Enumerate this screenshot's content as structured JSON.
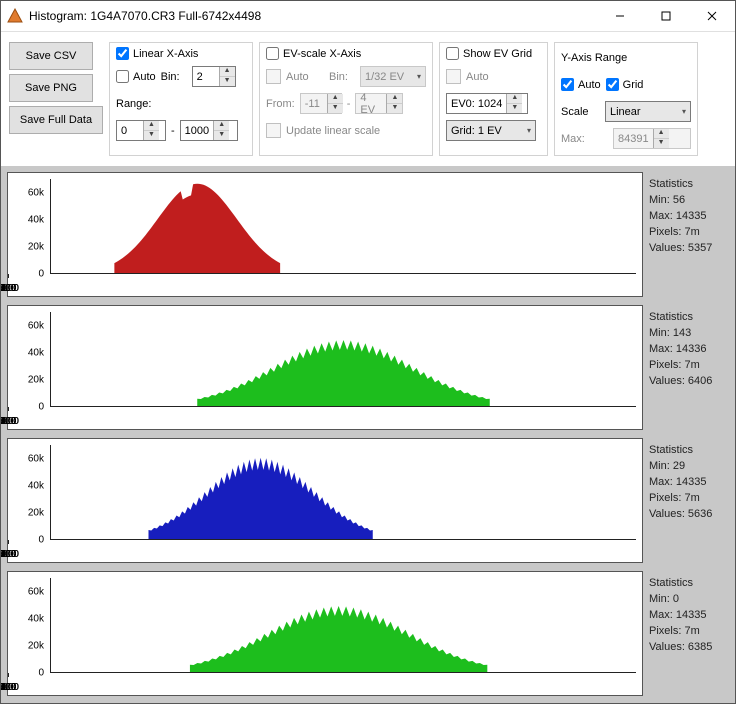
{
  "window": {
    "title": "Histogram: 1G4A7070.CR3 Full-6742x4498"
  },
  "buttons": {
    "saveCsv": "Save CSV",
    "savePng": "Save PNG",
    "saveFull": "Save Full Data"
  },
  "linearGroup": {
    "title": "Linear X-Axis",
    "auto": "Auto",
    "binLabel": "Bin:",
    "bin": "2",
    "rangeLabel": "Range:",
    "from": "0",
    "to": "1000"
  },
  "evGroup": {
    "title": "EV-scale X-Axis",
    "auto": "Auto",
    "binLabel": "Bin:",
    "binSel": "1/32 EV",
    "fromLabel": "From:",
    "from": "-11",
    "dash": "-",
    "to": "4 EV",
    "update": "Update linear scale"
  },
  "gridGroup": {
    "title": "Show EV Grid",
    "auto": "Auto",
    "ev0": "EV0: 1024",
    "gridSel": "Grid: 1 EV"
  },
  "yGroup": {
    "title": "Y-Axis Range",
    "auto": "Auto",
    "grid": "Grid",
    "scale": "Scale",
    "scaleSel": "Linear",
    "maxLabel": "Max:",
    "maxVal": "84391"
  },
  "axes": {
    "y": [
      "60k",
      "40k",
      "20k",
      "0"
    ],
    "x": [
      "0",
      "100",
      "200",
      "300",
      "400",
      "500",
      "600",
      "700",
      "800",
      "900",
      "1000",
      "1100"
    ]
  },
  "chart_data": [
    {
      "type": "area",
      "color": "#C01E1E",
      "center": 300,
      "halfwidth": 170,
      "height": 0.95,
      "notch": true,
      "xrange": [
        0,
        1200
      ],
      "ymax": 70000,
      "jagged": false
    },
    {
      "type": "area",
      "color": "#1DBE1D",
      "center": 600,
      "halfwidth": 300,
      "height": 0.65,
      "notch": false,
      "xrange": [
        0,
        1200
      ],
      "ymax": 70000,
      "jagged": true
    },
    {
      "type": "area",
      "color": "#171EBE",
      "center": 430,
      "halfwidth": 230,
      "height": 0.8,
      "notch": false,
      "xrange": [
        0,
        1200
      ],
      "ymax": 70000,
      "jagged": true
    },
    {
      "type": "area",
      "color": "#1DBE1D",
      "center": 590,
      "halfwidth": 305,
      "height": 0.65,
      "notch": false,
      "xrange": [
        0,
        1200
      ],
      "ymax": 70000,
      "jagged": true
    }
  ],
  "stats": [
    {
      "title": "Statistics",
      "min": "Min: 56",
      "max": "Max: 14335",
      "pixels": "Pixels: 7m",
      "values": "Values: 5357"
    },
    {
      "title": "Statistics",
      "min": "Min: 143",
      "max": "Max: 14336",
      "pixels": "Pixels: 7m",
      "values": "Values: 6406"
    },
    {
      "title": "Statistics",
      "min": "Min: 29",
      "max": "Max: 14335",
      "pixels": "Pixels: 7m",
      "values": "Values: 5636"
    },
    {
      "title": "Statistics",
      "min": "Min: 0",
      "max": "Max: 14335",
      "pixels": "Pixels: 7m",
      "values": "Values: 6385"
    }
  ]
}
